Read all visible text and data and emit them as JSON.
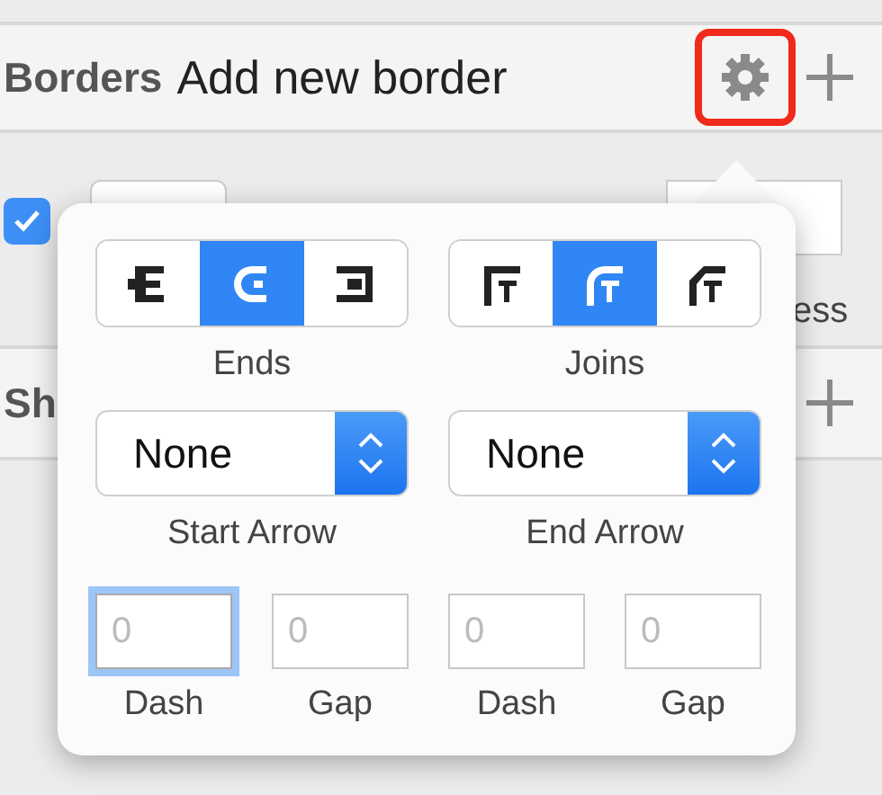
{
  "header": {
    "title": "Borders",
    "action": "Add new border"
  },
  "border_row": {
    "enabled": true,
    "thickness_label": "ess"
  },
  "shadows_header": {
    "title": "Sh"
  },
  "popover": {
    "segment_groups": [
      {
        "label": "Ends",
        "options": [
          {
            "kind": "butt",
            "selected": false
          },
          {
            "kind": "round",
            "selected": true
          },
          {
            "kind": "square",
            "selected": false
          }
        ]
      },
      {
        "label": "Joins",
        "options": [
          {
            "kind": "miter",
            "selected": false
          },
          {
            "kind": "round",
            "selected": true
          },
          {
            "kind": "bevel",
            "selected": false
          }
        ]
      }
    ],
    "arrows": [
      {
        "label": "Start Arrow",
        "value": "None"
      },
      {
        "label": "End Arrow",
        "value": "None"
      }
    ],
    "dash_fields": [
      {
        "label": "Dash",
        "placeholder": "0",
        "focused": true
      },
      {
        "label": "Gap",
        "placeholder": "0",
        "focused": false
      },
      {
        "label": "Dash",
        "placeholder": "0",
        "focused": false
      },
      {
        "label": "Gap",
        "placeholder": "0",
        "focused": false
      }
    ]
  }
}
